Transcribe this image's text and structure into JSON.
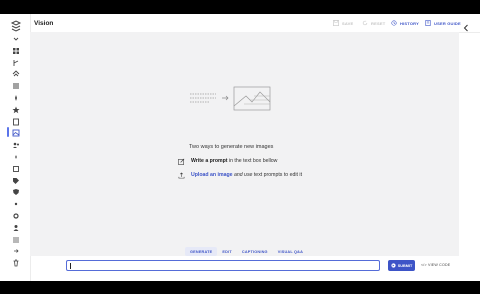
{
  "header": {
    "title": "Vision",
    "buttons": [
      {
        "label": "SAVE",
        "icon": "save-icon",
        "state": "disabled"
      },
      {
        "label": "RESET",
        "icon": "reset-icon",
        "state": "disabled"
      },
      {
        "label": "HISTORY",
        "icon": "history-icon",
        "state": "active"
      },
      {
        "label": "USER GUIDE",
        "icon": "book-icon",
        "state": "active"
      }
    ]
  },
  "sidebar": {
    "logo_icon": "app-logo-icon",
    "active_index": 8,
    "items": [
      "chevron-icon",
      "grid-icon",
      "branch-icon",
      "layers-icon",
      "stack-icon",
      "sparkle-icon",
      "star-icon",
      "document-icon",
      "image-icon",
      "people-icon",
      "star-small-icon",
      "box-icon",
      "tag-icon",
      "shield-icon",
      "dot-icon",
      "gear-icon",
      "person-icon",
      "list-icon",
      "arrow-icon",
      "trash-icon"
    ]
  },
  "main": {
    "heading": "Two ways to generate new images",
    "option1": {
      "bold": "Write a prompt",
      "rest": " in the text box bellow"
    },
    "option2": {
      "link": "Upload an image",
      "italic": " and use",
      "rest": " text prompts to edit it"
    }
  },
  "tabs": [
    {
      "label": "GENERATE",
      "selected": true
    },
    {
      "label": "EDIT",
      "selected": false
    },
    {
      "label": "CAPTIONING",
      "selected": false
    },
    {
      "label": "VISUAL Q&A",
      "selected": false
    }
  ],
  "prompt": {
    "value": "",
    "placeholder": ""
  },
  "submit_label": "SUBMIT",
  "view_code_label": "VIEW CODE",
  "colors": {
    "accent": "#3d54c7",
    "canvas": "#f2f2f3",
    "disabled": "#c4c4c4"
  }
}
